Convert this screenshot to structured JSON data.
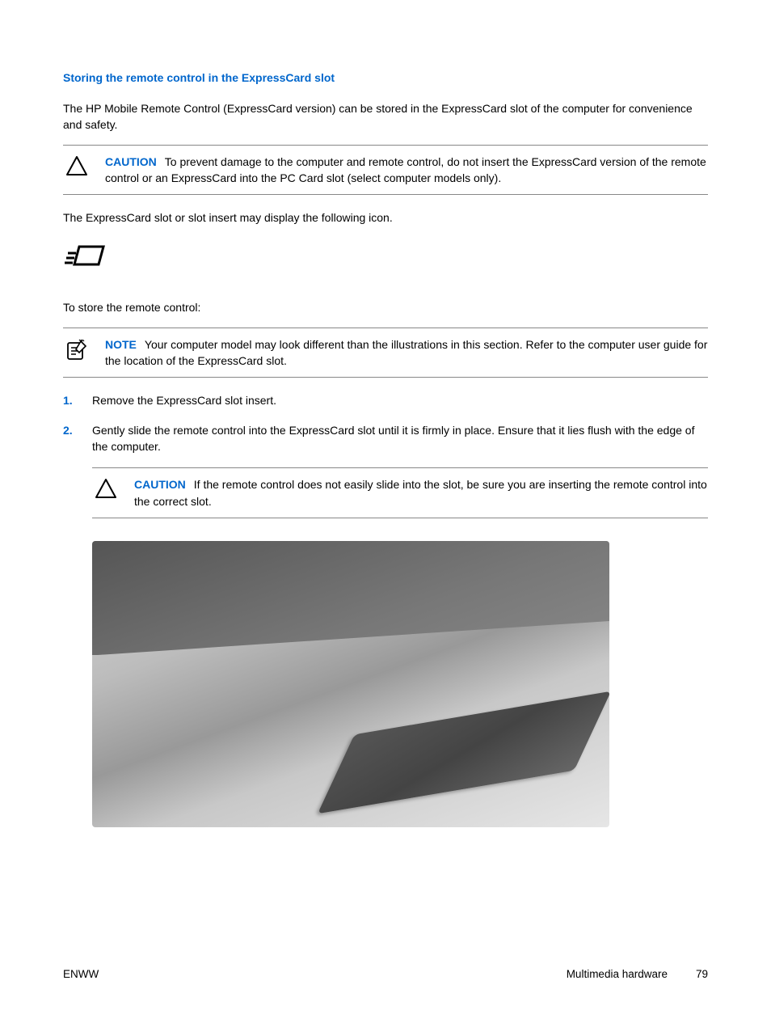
{
  "heading": "Storing the remote control in the ExpressCard slot",
  "intro": "The HP Mobile Remote Control (ExpressCard version) can be stored in the ExpressCard slot of the computer for convenience and safety.",
  "caution1": {
    "label": "CAUTION",
    "text": "To prevent damage to the computer and remote control, do not insert the ExpressCard version of the remote control or an ExpressCard into the PC Card slot (select computer models only)."
  },
  "icon_intro": "The ExpressCard slot or slot insert may display the following icon.",
  "store_intro": "To store the remote control:",
  "note1": {
    "label": "NOTE",
    "text": "Your computer model may look different than the illustrations in this section. Refer to the computer user guide for the location of the ExpressCard slot."
  },
  "steps": [
    {
      "num": "1.",
      "text": "Remove the ExpressCard slot insert."
    },
    {
      "num": "2.",
      "text": "Gently slide the remote control into the ExpressCard slot until it is firmly in place. Ensure that it lies flush with the edge of the computer."
    }
  ],
  "caution2": {
    "label": "CAUTION",
    "text": "If the remote control does not easily slide into the slot, be sure you are inserting the remote control into the correct slot."
  },
  "footer": {
    "left": "ENWW",
    "section": "Multimedia hardware",
    "page": "79"
  }
}
